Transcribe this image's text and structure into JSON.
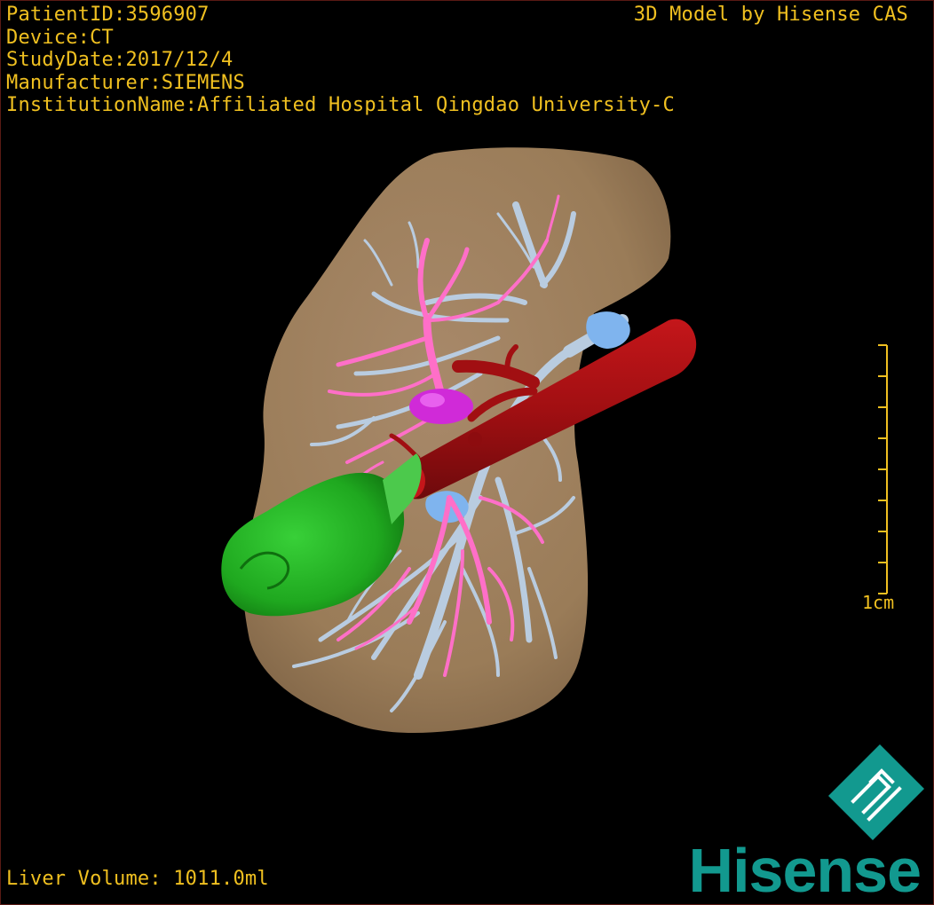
{
  "header": {
    "patient_id": "PatientID:3596907",
    "device": "Device:CT",
    "study_date": "StudyDate:2017/12/4",
    "manufacturer": "Manufacturer:SIEMENS",
    "institution": "InstitutionName:Affiliated Hospital Qingdao University-C"
  },
  "credit": "3D Model by Hisense CAS",
  "scale": {
    "label": "1cm"
  },
  "footer": {
    "liver_volume": "Liver Volume: 1011.0ml"
  },
  "brand": {
    "name": "Hisense",
    "color": "#12998f"
  },
  "colors": {
    "text": "#f0c020",
    "liver": "#9a7c58",
    "hepatic_vein": "#b9cce0",
    "portal_vein": "#ff6fc8",
    "vena_cava": "#a10f12",
    "tumor": "#1fb01f",
    "gallbladder_blue": "#7fb4ee",
    "magenta_node": "#d02ad8"
  }
}
